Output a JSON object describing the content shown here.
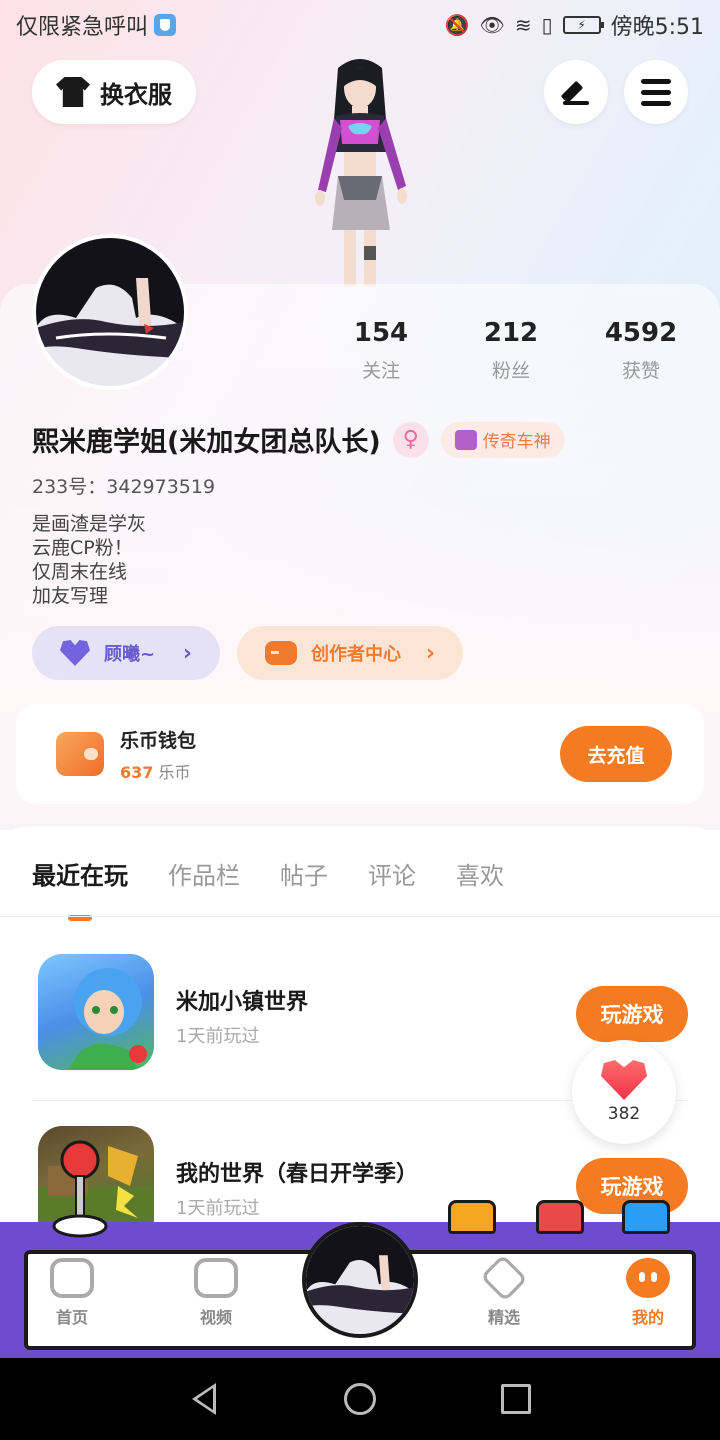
{
  "status_bar": {
    "left_text": "仅限紧急呼叫",
    "right_time": "傍晚5:51"
  },
  "top_bar": {
    "dress_label": "换衣服"
  },
  "profile": {
    "stats": [
      {
        "value": "154",
        "label": "关注"
      },
      {
        "value": "212",
        "label": "粉丝"
      },
      {
        "value": "4592",
        "label": "获赞"
      }
    ],
    "name": "熙米鹿学姐(米加女团总队长)",
    "gender_symbol": "♀",
    "title_badge": "传奇车神",
    "uid": "233号：342973519",
    "bio_lines": [
      "是画渣是学灰",
      "云鹿CP粉！",
      "仅周末在线",
      "加友写理"
    ],
    "guard_label": "顾曦~",
    "creator_label": "创作者中心"
  },
  "wallet": {
    "title": "乐币钱包",
    "amount": "637",
    "unit": "乐币",
    "recharge_label": "去充值"
  },
  "tabs": [
    "最近在玩",
    "作品栏",
    "帖子",
    "评论",
    "喜欢"
  ],
  "games": [
    {
      "name": "米加小镇世界",
      "time": "1天前玩过",
      "play_label": "玩游戏"
    },
    {
      "name": "我的世界（春日开学季）",
      "time": "1天前玩过",
      "play_label": "玩游戏"
    }
  ],
  "like_float": {
    "count": "382"
  },
  "bottom_nav": {
    "home": "首页",
    "video": "视频",
    "picks": "精选",
    "mine": "我的"
  },
  "colors": {
    "accent": "#f57b22",
    "purple": "#6e4ccf",
    "guard_purple": "#6a5ad2"
  }
}
